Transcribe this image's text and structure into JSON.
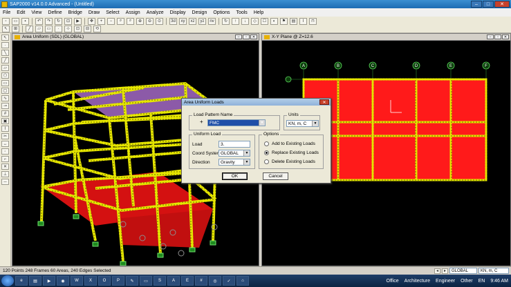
{
  "window": {
    "title": "SAP2000 v14.0.0 Advanced  - (Untitled)"
  },
  "menu": [
    "File",
    "Edit",
    "View",
    "Define",
    "Bridge",
    "Draw",
    "Select",
    "Assign",
    "Analyze",
    "Display",
    "Design",
    "Options",
    "Tools",
    "Help"
  ],
  "toolbar": {
    "view_3d": "3d",
    "view_xy": "xy",
    "view_xz": "xz",
    "view_yz": "yz",
    "view_nv": "nv"
  },
  "panels": {
    "left": {
      "title": "Area Uniform (SDL)  (GLOBAL)"
    },
    "right": {
      "title": "X-Y Plane @ Z=12.6"
    }
  },
  "grid_labels": [
    "A",
    "B",
    "C",
    "D",
    "E",
    "F"
  ],
  "dialog": {
    "title": "Area Uniform Loads",
    "load_pattern_group": "Load Pattern Name",
    "load_pattern_value": "FMC",
    "units_group": "Units",
    "units_value": "KN, m, C",
    "uniform_load_group": "Uniform Load",
    "load_label": "Load",
    "load_value": "3.",
    "coord_label": "Coord System",
    "coord_value": "GLOBAL",
    "direction_label": "Direction",
    "direction_value": "Gravity",
    "options_group": "Options",
    "option_add": "Add to Existing Loads",
    "option_replace": "Replace Existing Loads",
    "option_delete": "Delete Existing Loads",
    "ok": "OK",
    "cancel": "Cancel"
  },
  "status": {
    "text": "120 Points  248 Frames  60 Areas, 240 Edges Selected",
    "coord": "GLOBAL",
    "units": "KN, m, C"
  },
  "taskbar": {
    "items": [
      "Office",
      "Architecture",
      "Engineer",
      "Other"
    ],
    "lang": "EN",
    "time": "9:46 AM"
  }
}
